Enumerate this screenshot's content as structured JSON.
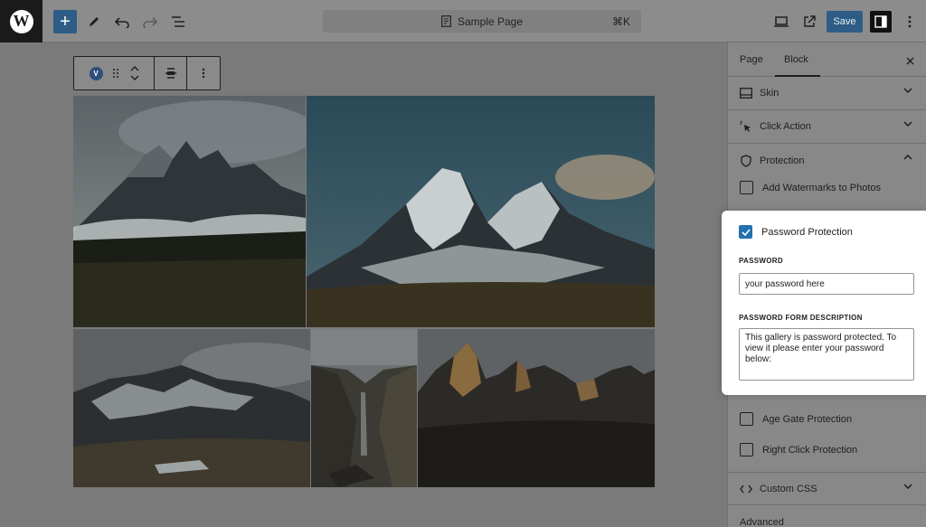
{
  "topbar": {
    "command_title": "Sample Page",
    "shortcut": "⌘K",
    "save_label": "Save"
  },
  "block_toolbar": {
    "block_badge": "V"
  },
  "sidebar": {
    "tabs": [
      {
        "label": "Page",
        "active": false
      },
      {
        "label": "Block",
        "active": true
      }
    ],
    "panels": {
      "skin": "Skin",
      "click_action": "Click Action",
      "protection": "Protection",
      "custom_css": "Custom CSS",
      "advanced": "Advanced"
    },
    "options": {
      "watermarks": {
        "label": "Add Watermarks to Photos",
        "checked": false
      },
      "password_protection": {
        "label": "Password Protection",
        "checked": true
      },
      "age_gate": {
        "label": "Age Gate Protection",
        "checked": false
      },
      "right_click": {
        "label": "Right Click Protection",
        "checked": false
      }
    },
    "password": {
      "label": "PASSWORD",
      "value": "your password here"
    },
    "description": {
      "label": "PASSWORD FORM DESCRIPTION",
      "value": "This gallery is password protected. To view it please enter your password below:"
    }
  },
  "colors": {
    "accent": "#2271b1",
    "overlay_dim": "#7a7a7a"
  }
}
